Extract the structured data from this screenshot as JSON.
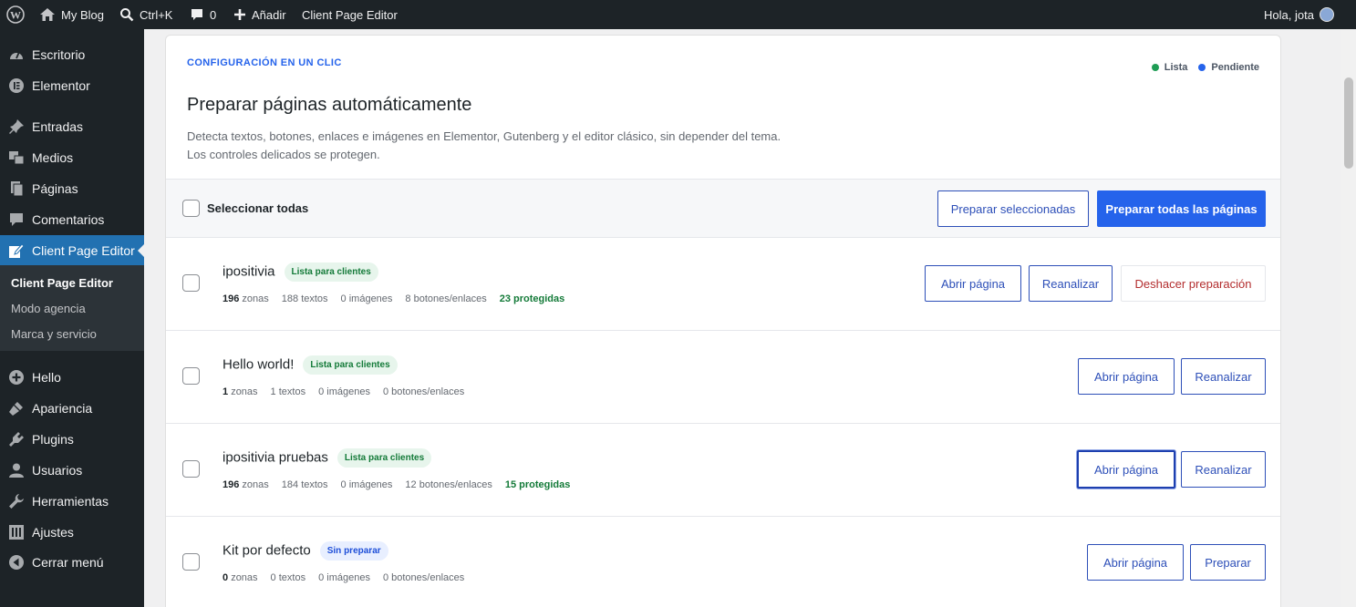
{
  "adminbar": {
    "site": "My Blog",
    "search": "Ctrl+K",
    "comments": "0",
    "new": "Añadir",
    "plugin": "Client Page Editor",
    "greeting": "Hola, jota"
  },
  "sidebar": {
    "items": [
      {
        "label": "Escritorio",
        "icon": "dashboard-icon"
      },
      {
        "label": "Elementor",
        "icon": "elementor-icon"
      },
      {
        "label": "Entradas",
        "icon": "pin-icon"
      },
      {
        "label": "Medios",
        "icon": "media-icon"
      },
      {
        "label": "Páginas",
        "icon": "pages-icon"
      },
      {
        "label": "Comentarios",
        "icon": "comment-icon"
      },
      {
        "label": "Client Page Editor",
        "icon": "edit-page-icon"
      },
      {
        "label": "Hello",
        "icon": "plus-circle-icon"
      },
      {
        "label": "Apariencia",
        "icon": "brush-icon"
      },
      {
        "label": "Plugins",
        "icon": "plug-icon"
      },
      {
        "label": "Usuarios",
        "icon": "user-icon"
      },
      {
        "label": "Herramientas",
        "icon": "wrench-icon"
      },
      {
        "label": "Ajustes",
        "icon": "settings-icon"
      },
      {
        "label": "Cerrar menú",
        "icon": "collapse-icon"
      }
    ],
    "submenu": [
      "Client Page Editor",
      "Modo agencia",
      "Marca y servicio"
    ]
  },
  "panel": {
    "eyebrow": "CONFIGURACIÓN EN UN CLIC",
    "legend_ready": "Lista",
    "legend_pending": "Pendiente",
    "title": "Preparar páginas automáticamente",
    "description": "Detecta textos, botones, enlaces e imágenes en Elementor, Gutenberg y el editor clásico, sin depender del tema. Los controles delicados se protegen.",
    "select_all": "Seleccionar todas",
    "prepare_selected": "Preparar seleccionadas",
    "prepare_all": "Preparar todas las páginas"
  },
  "colors": {
    "ready": "#1f9d55",
    "pending": "#2563eb",
    "accent": "#2563eb",
    "danger": "#b32d2e"
  },
  "pages": [
    {
      "name": "ipositivia",
      "badge": "Lista para clientes",
      "zones": "196",
      "zones_label": "zonas",
      "texts": "188 textos",
      "images": "0 imágenes",
      "buttons": "8 botones/enlaces",
      "protected": "23 protegidas",
      "btn_open": "Abrir página",
      "btn_reanalyze": "Reanalizar",
      "btn_undo": "Deshacer preparación"
    },
    {
      "name": "Hello world!",
      "badge": "Lista para clientes",
      "zones": "1",
      "zones_label": "zonas",
      "texts": "1 textos",
      "images": "0 imágenes",
      "buttons": "0 botones/enlaces",
      "btn_open": "Abrir página",
      "btn_reanalyze": "Reanalizar"
    },
    {
      "name": "ipositivia pruebas",
      "badge": "Lista para clientes",
      "zones": "196",
      "zones_label": "zonas",
      "texts": "184 textos",
      "images": "0 imágenes",
      "buttons": "12 botones/enlaces",
      "protected": "15 protegidas",
      "btn_open": "Abrir página",
      "btn_reanalyze": "Reanalizar"
    },
    {
      "name": "Kit por defecto",
      "badge": "Sin preparar",
      "zones": "0",
      "zones_label": "zonas",
      "texts": "0 textos",
      "images": "0 imágenes",
      "buttons": "0 botones/enlaces",
      "btn_open": "Abrir página",
      "btn_prepare": "Preparar"
    }
  ]
}
